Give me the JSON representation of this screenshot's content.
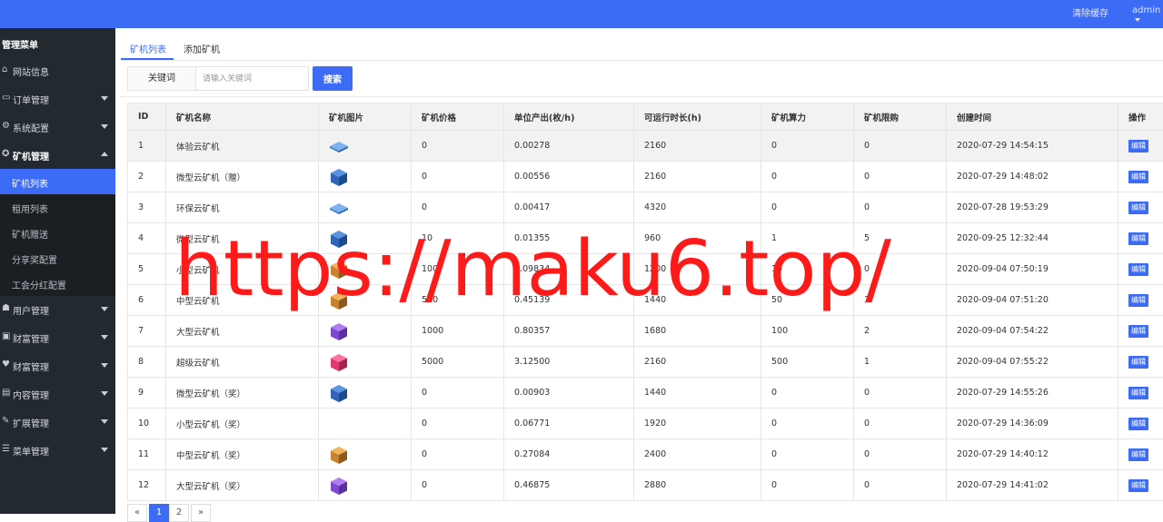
{
  "topbar": {
    "clear_cache": "清除缓存",
    "user": "admin"
  },
  "sidebar": {
    "title": "管理菜单",
    "items": [
      {
        "icon": "home-icon",
        "glyph": "⌂",
        "label": "网站信息",
        "arrow": "none"
      },
      {
        "icon": "order-icon",
        "glyph": "▭",
        "label": "订单管理",
        "arrow": "down"
      },
      {
        "icon": "gear-icon",
        "glyph": "⚙",
        "label": "系统配置",
        "arrow": "down"
      },
      {
        "icon": "miner-icon",
        "glyph": "✪",
        "label": "矿机管理",
        "arrow": "up"
      },
      {
        "icon": "users-icon",
        "glyph": "☗",
        "label": "用户管理",
        "arrow": "down"
      },
      {
        "icon": "money-icon",
        "glyph": "▣",
        "label": "财富管理",
        "arrow": "down"
      },
      {
        "icon": "heart-icon",
        "glyph": "♥",
        "label": "财富管理",
        "arrow": "down"
      },
      {
        "icon": "content-icon",
        "glyph": "▤",
        "label": "内容管理",
        "arrow": "down"
      },
      {
        "icon": "wrench-icon",
        "glyph": "✎",
        "label": "扩展管理",
        "arrow": "down"
      },
      {
        "icon": "menu-icon",
        "glyph": "☰",
        "label": "菜单管理",
        "arrow": "down"
      }
    ],
    "sub_items": [
      "矿机列表",
      "租用列表",
      "矿机赠送",
      "分享奖配置",
      "工会分红配置"
    ]
  },
  "tabs": [
    "矿机列表",
    "添加矿机"
  ],
  "search": {
    "label": "关键词",
    "placeholder": "请输入关键词",
    "button": "搜索"
  },
  "table": {
    "headers": [
      "ID",
      "矿机名称",
      "矿机图片",
      "矿机价格",
      "单位产出(枚/h)",
      "可运行时长(h)",
      "矿机算力",
      "矿机限购",
      "创建时间",
      "操作"
    ],
    "edit_label": "编辑",
    "rows": [
      {
        "id": "1",
        "name": "体验云矿机",
        "img": "flat-blue",
        "price": "0",
        "output": "0.00278",
        "hours": "2160",
        "power": "0",
        "limit": "0",
        "created": "2020-07-29 14:54:15"
      },
      {
        "id": "2",
        "name": "微型云矿机（赠）",
        "img": "cube-blue",
        "price": "0",
        "output": "0.00556",
        "hours": "2160",
        "power": "0",
        "limit": "0",
        "created": "2020-07-29 14:48:02"
      },
      {
        "id": "3",
        "name": "环保云矿机",
        "img": "flat-blue",
        "price": "0",
        "output": "0.00417",
        "hours": "4320",
        "power": "0",
        "limit": "0",
        "created": "2020-07-28 19:53:29"
      },
      {
        "id": "4",
        "name": "微型云矿机",
        "img": "cube-blue",
        "price": "10",
        "output": "0.01355",
        "hours": "960",
        "power": "1",
        "limit": "5",
        "created": "2020-09-25 12:32:44"
      },
      {
        "id": "5",
        "name": "小型云矿机",
        "img": "cube-orange",
        "price": "100",
        "output": "0.09834",
        "hours": "1200",
        "power": "10",
        "limit": "0",
        "created": "2020-09-04 07:50:19"
      },
      {
        "id": "6",
        "name": "中型云矿机",
        "img": "cube-orange",
        "price": "500",
        "output": "0.45139",
        "hours": "1440",
        "power": "50",
        "limit": "3",
        "created": "2020-09-04 07:51:20"
      },
      {
        "id": "7",
        "name": "大型云矿机",
        "img": "cube-purple",
        "price": "1000",
        "output": "0.80357",
        "hours": "1680",
        "power": "100",
        "limit": "2",
        "created": "2020-09-04 07:54:22"
      },
      {
        "id": "8",
        "name": "超级云矿机",
        "img": "cube-pink",
        "price": "5000",
        "output": "3.12500",
        "hours": "2160",
        "power": "500",
        "limit": "1",
        "created": "2020-09-04 07:55:22"
      },
      {
        "id": "9",
        "name": "微型云矿机（奖）",
        "img": "cube-blue",
        "price": "0",
        "output": "0.00903",
        "hours": "1440",
        "power": "0",
        "limit": "0",
        "created": "2020-07-29 14:55:26"
      },
      {
        "id": "10",
        "name": "小型云矿机（奖）",
        "img": "",
        "price": "0",
        "output": "0.06771",
        "hours": "1920",
        "power": "0",
        "limit": "0",
        "created": "2020-07-29 14:36:09"
      },
      {
        "id": "11",
        "name": "中型云矿机（奖）",
        "img": "cube-orange",
        "price": "0",
        "output": "0.27084",
        "hours": "2400",
        "power": "0",
        "limit": "0",
        "created": "2020-07-29 14:40:12"
      },
      {
        "id": "12",
        "name": "大型云矿机（奖）",
        "img": "cube-purple",
        "price": "0",
        "output": "0.46875",
        "hours": "2880",
        "power": "0",
        "limit": "0",
        "created": "2020-07-29 14:41:02"
      }
    ]
  },
  "pagination": {
    "prev": "«",
    "pages": [
      "1",
      "2"
    ],
    "current": "1",
    "next": "»"
  },
  "watermark": "https://maku6.top/",
  "colors": {
    "primary": "#3c6cf5",
    "sidebar": "#22292f",
    "watermark": "#ff1a1a"
  }
}
